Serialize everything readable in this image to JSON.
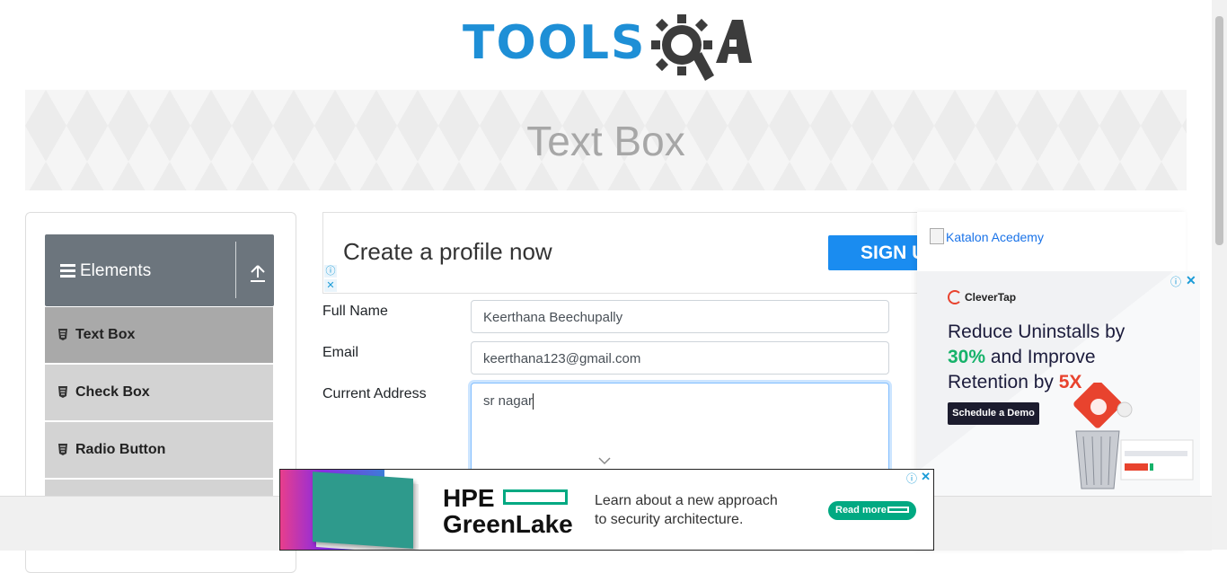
{
  "header": {
    "logo_text": "TOOLS",
    "logo_accent": "QA"
  },
  "banner": {
    "title": "Text Box"
  },
  "sidebar": {
    "group_title": "Elements",
    "items": [
      {
        "label": "Text Box",
        "active": true
      },
      {
        "label": "Check Box",
        "active": false
      },
      {
        "label": "Radio Button",
        "active": false
      }
    ]
  },
  "ad_top": {
    "headline": "Create a profile now",
    "cta": "SIGN U"
  },
  "form": {
    "full_name": {
      "label": "Full Name",
      "value": "Keerthana Beechupally"
    },
    "email": {
      "label": "Email",
      "value": "keerthana123@gmail.com"
    },
    "current_address": {
      "label": "Current Address",
      "value": "sr nagar"
    }
  },
  "ad_right": {
    "image_alt": "Katalon Acedemy",
    "brand": "CleverTap",
    "copy_1": "Reduce Uninstalls by",
    "copy_pct": "30%",
    "copy_2": " and Improve",
    "copy_3": "Retention by ",
    "copy_x": "5X",
    "button": "Schedule a Demo"
  },
  "ad_bottom": {
    "brand_line1": "HPE",
    "brand_line2": "GreenLake",
    "copy_line1": "Learn about a new approach",
    "copy_line2": "to security architecture.",
    "button": "Read more"
  },
  "colors": {
    "accent": "#1e8fd6",
    "sidebar_header": "#6c757d",
    "sidebar_item": "#d3d3d3",
    "sidebar_active": "#a9a9a9",
    "hpe_green": "#01a982"
  }
}
